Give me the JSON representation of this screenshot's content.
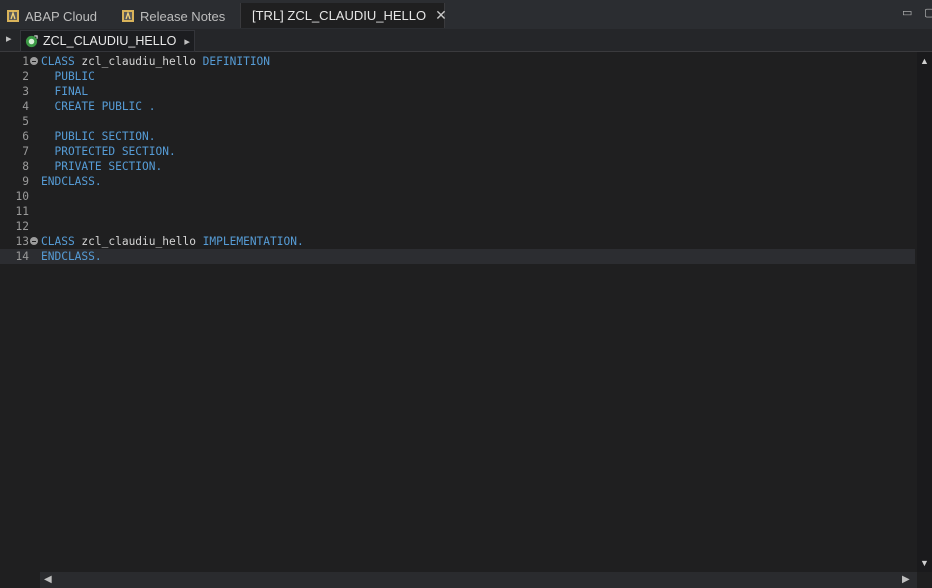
{
  "tabs": [
    {
      "label": "ABAP Cloud",
      "icon": "abap-doc-icon"
    },
    {
      "label": "Release Notes",
      "icon": "abap-doc-icon"
    },
    {
      "label": "[TRL] ZCL_CLAUDIU_HELLO",
      "icon": "abap-class-icon",
      "active": true,
      "close": "✕"
    }
  ],
  "window": {
    "minimize": "▭",
    "maximize": "▢"
  },
  "breadcrumb": {
    "label": "ZCL_CLAUDIU_HELLO",
    "left_arrow": "▸",
    "right_arrow": "▸"
  },
  "editor": {
    "line_numbers": [
      "1",
      "2",
      "3",
      "4",
      "5",
      "6",
      "7",
      "8",
      "9",
      "10",
      "11",
      "12",
      "13",
      "14"
    ],
    "current_line": 14,
    "lines": [
      [
        {
          "t": "CLASS",
          "c": "kw"
        },
        {
          "t": " zcl_claudiu_hello ",
          "c": "id"
        },
        {
          "t": "DEFINITION",
          "c": "kw"
        }
      ],
      [
        {
          "t": "  PUBLIC",
          "c": "kw"
        }
      ],
      [
        {
          "t": "  FINAL",
          "c": "kw"
        }
      ],
      [
        {
          "t": "  CREATE PUBLIC .",
          "c": "kw"
        }
      ],
      [],
      [
        {
          "t": "  PUBLIC SECTION.",
          "c": "kw"
        }
      ],
      [
        {
          "t": "  PROTECTED SECTION.",
          "c": "kw"
        }
      ],
      [
        {
          "t": "  PRIVATE SECTION.",
          "c": "kw"
        }
      ],
      [
        {
          "t": "ENDCLASS.",
          "c": "kw"
        }
      ],
      [],
      [],
      [],
      [
        {
          "t": "CLASS",
          "c": "kw"
        },
        {
          "t": " zcl_claudiu_hello ",
          "c": "id"
        },
        {
          "t": "IMPLEMENTATION.",
          "c": "kw"
        }
      ],
      [
        {
          "t": "ENDCLASS.",
          "c": "kw"
        }
      ]
    ],
    "fold_lines": [
      1,
      13
    ]
  },
  "colors": {
    "keyword": "#569cd6",
    "identifier": "#d4d4d4",
    "background": "#1f1f20"
  }
}
